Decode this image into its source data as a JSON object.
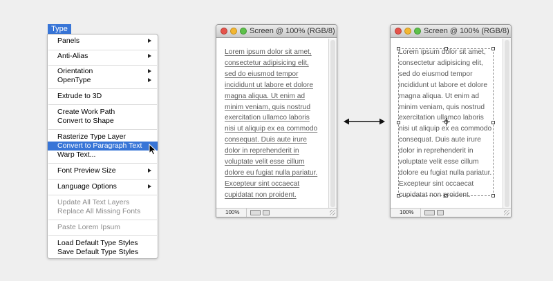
{
  "menu": {
    "title": "Type",
    "items": [
      {
        "label": "Panels",
        "submenu": true
      },
      {
        "label": "Anti-Alias",
        "submenu": true
      },
      {
        "label": "Orientation",
        "submenu": true
      },
      {
        "label": "OpenType",
        "submenu": true
      },
      {
        "label": "Extrude to 3D"
      },
      {
        "label": "Create Work Path"
      },
      {
        "label": "Convert to Shape"
      },
      {
        "label": "Rasterize Type Layer"
      },
      {
        "label": "Convert to Paragraph Text",
        "highlighted": true
      },
      {
        "label": "Warp Text..."
      },
      {
        "label": "Font Preview Size",
        "submenu": true
      },
      {
        "label": "Language Options",
        "submenu": true
      },
      {
        "label": "Update All Text Layers",
        "disabled": true
      },
      {
        "label": "Replace All Missing Fonts",
        "disabled": true
      },
      {
        "label": "Paste Lorem Ipsum",
        "disabled": true
      },
      {
        "label": "Load Default Type Styles"
      },
      {
        "label": "Save Default Type Styles"
      }
    ]
  },
  "windows": [
    {
      "title": "Screen @ 100% (RGB/8)",
      "zoom": "100%",
      "mode": "point-text",
      "lines": [
        "Lorem ipsum dolor sit amet,",
        "consectetur adipisicing elit,",
        "sed do eiusmod tempor",
        "incididunt ut labore et dolore",
        "magna aliqua. Ut enim ad",
        "minim veniam, quis nostrud",
        "exercitation ullamco laboris",
        "nisi ut aliquip ex ea commodo",
        "consequat. Duis aute irure",
        "dolor in reprehenderit in",
        "voluptate velit esse cillum",
        "dolore eu fugiat nulla pariatur.",
        "Excepteur sint occaecat",
        "cupidatat non proident."
      ]
    },
    {
      "title": "Screen @ 100% (RGB/8)",
      "zoom": "100%",
      "mode": "paragraph-text",
      "lines": [
        "Lorem ipsum dolor sit amet,",
        "consectetur adipisicing elit,",
        "sed do eiusmod tempor",
        "incididunt ut labore et dolore",
        "magna aliqua. Ut enim ad",
        "minim veniam, quis nostrud",
        "exercitation ullamco laboris",
        "nisi ut aliquip ex ea commodo",
        "consequat. Duis aute irure",
        "dolor in reprehenderit in",
        "voluptate velit esse cillum",
        "dolore eu fugiat nulla pariatur.",
        "Excepteur sint occaecat",
        "cupidatat non proident."
      ]
    }
  ],
  "icons": {
    "cursor": "arrow-cursor-icon",
    "between_windows": "double-arrow-icon"
  },
  "colors": {
    "highlight": "#3875d7",
    "close": "#e5534b",
    "minimize": "#f2b632",
    "zoom": "#5ec14a"
  }
}
